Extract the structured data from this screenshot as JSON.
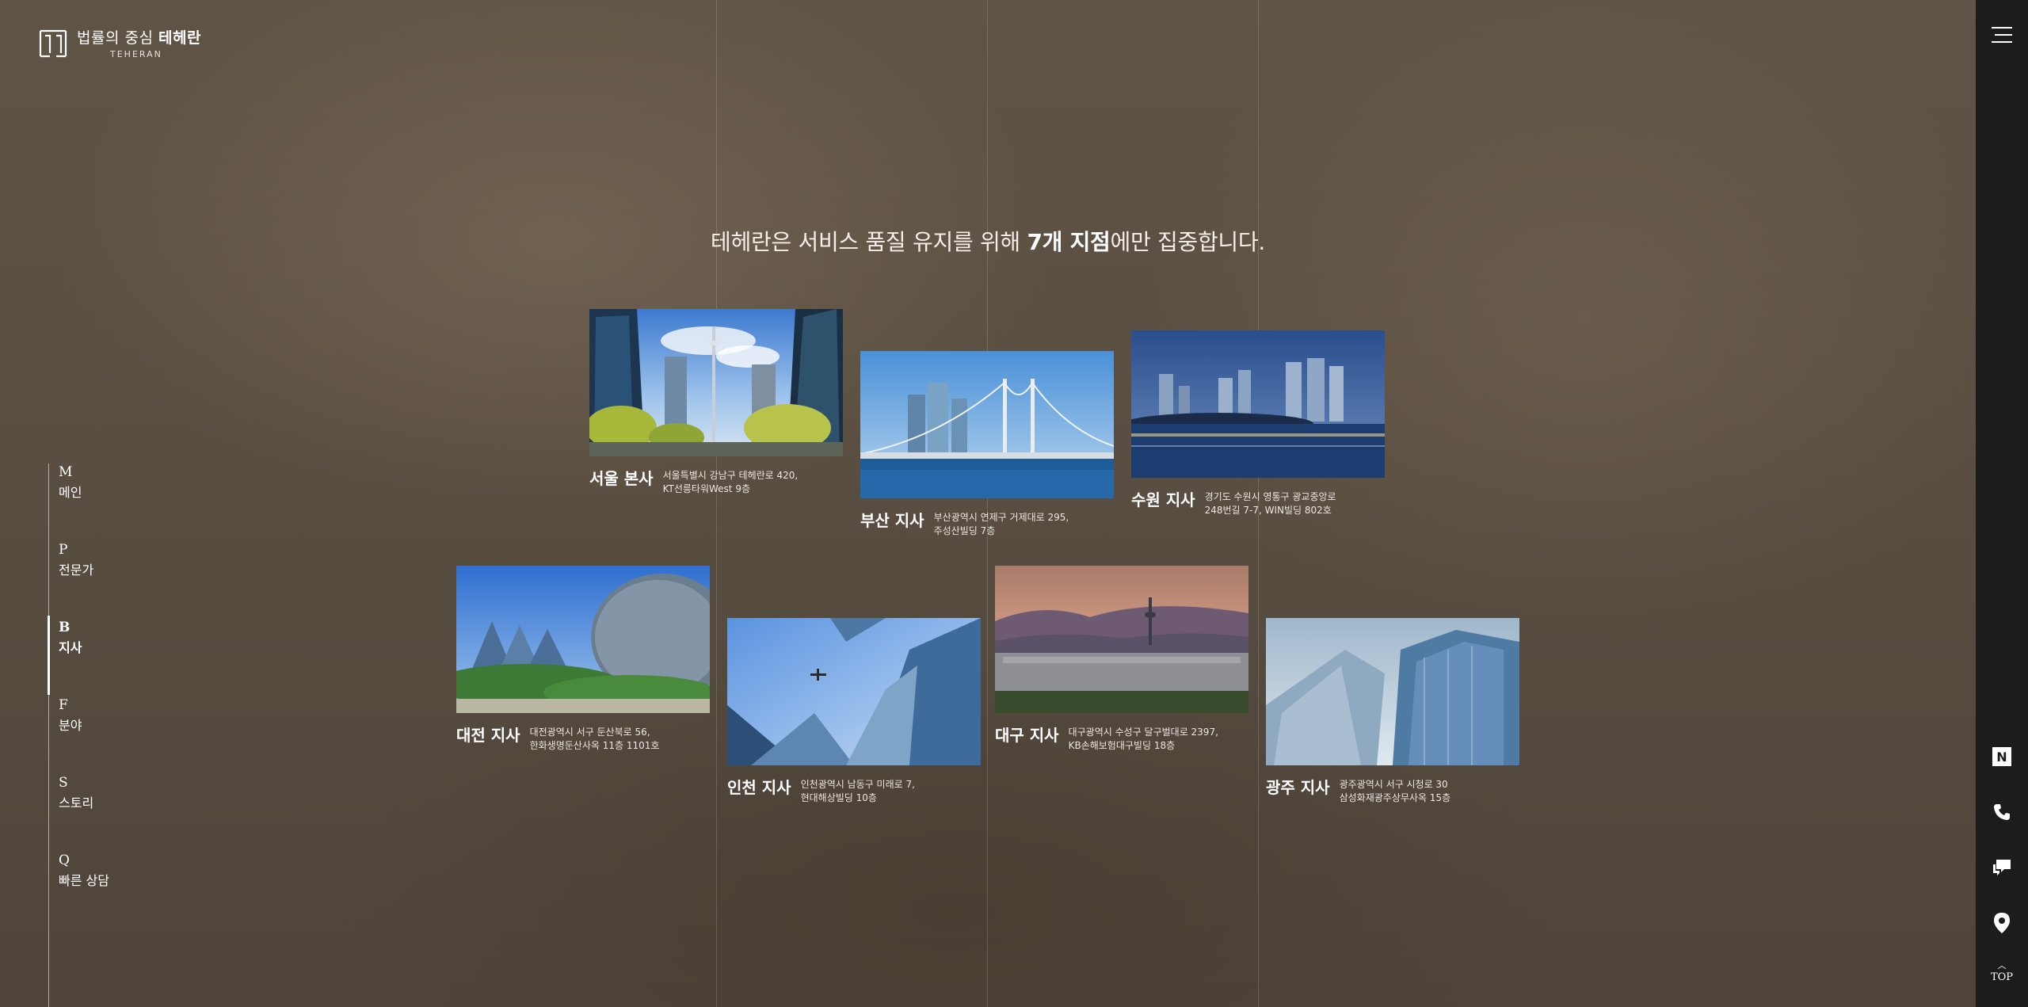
{
  "brand": {
    "title_light": "법률의 중심",
    "title_bold": "테헤란",
    "subtitle": "TEHERAN"
  },
  "nav": [
    {
      "letter": "M",
      "label": "메인"
    },
    {
      "letter": "P",
      "label": "전문가"
    },
    {
      "letter": "B",
      "label": "지사",
      "active": true
    },
    {
      "letter": "F",
      "label": "분야"
    },
    {
      "letter": "S",
      "label": "스토리"
    },
    {
      "letter": "Q",
      "label": "빠른 상담"
    }
  ],
  "headline": {
    "before": "테헤란은 서비스 품질 유지를 위해 ",
    "bold": "7개 지점",
    "after": "에만 집중합니다."
  },
  "branches": [
    {
      "name": "서울 본사",
      "addr1": "서울특별시 강남구 테헤란로 420,",
      "addr2": "KT선릉타워West 9층"
    },
    {
      "name": "부산 지사",
      "addr1": "부산광역시 연제구 거제대로 295,",
      "addr2": "주성산빌딩 7층"
    },
    {
      "name": "수원 지사",
      "addr1": "경기도 수원시 영통구 광교중앙로",
      "addr2": "248번길 7-7, WIN빌딩 802호"
    },
    {
      "name": "대전 지사",
      "addr1": "대전광역시 서구 둔산북로 56,",
      "addr2": "한화생명둔산사옥 11층 1101호"
    },
    {
      "name": "인천 지사",
      "addr1": "인천광역시 남동구 미래로 7,",
      "addr2": "현대해상빌딩 10층"
    },
    {
      "name": "대구 지사",
      "addr1": "대구광역시 수성구 달구벌대로 2397,",
      "addr2": "KB손해보험대구빌딩 18층"
    },
    {
      "name": "광주 지사",
      "addr1": "광주광역시 서구 시청로 30",
      "addr2": "삼성화재광주상무사옥 15층"
    }
  ],
  "right_bar": {
    "icons": [
      "menu-icon",
      "naver-blog-icon",
      "phone-icon",
      "chat-icon",
      "location-pin-icon"
    ],
    "naver_letter": "N",
    "top_label": "TOP",
    "top_arrow": "︿"
  },
  "colors": {
    "right_bar_bg": "#1c1c1c",
    "text": "#ffffff",
    "background": "#5a4f42"
  }
}
